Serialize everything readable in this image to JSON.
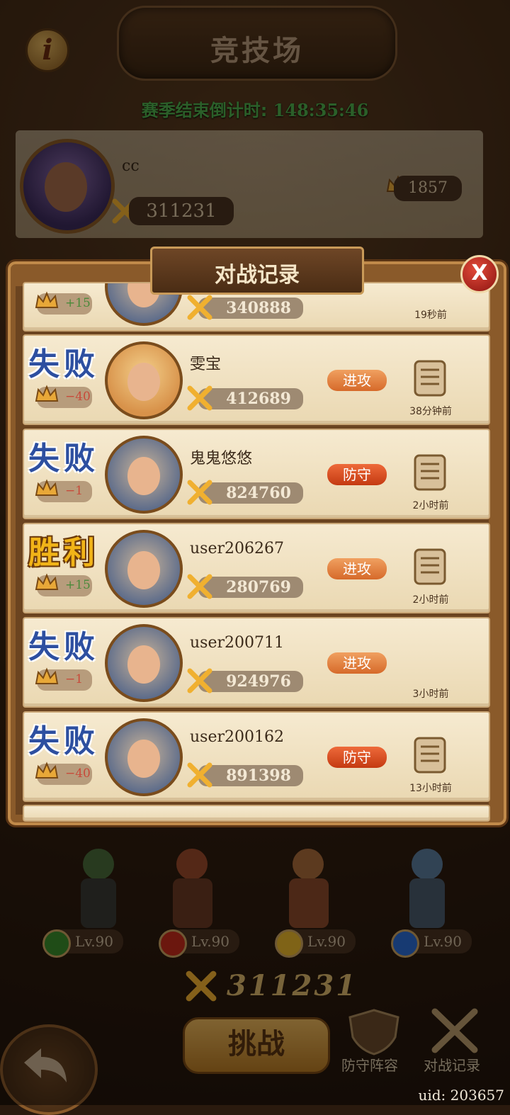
{
  "header": {
    "title": "竞技场",
    "info_icon": "i",
    "countdown_label": "赛季结束倒计时:",
    "countdown_value": "148:35:46"
  },
  "player": {
    "name": "cc",
    "power": "311231",
    "rank_points": "1857"
  },
  "records_dialog": {
    "title": "对战记录",
    "close_label": "X",
    "partial_top": {
      "delta": "+15",
      "power": "340888",
      "ago": "19秒前"
    },
    "rows": [
      {
        "result": "失败",
        "outcome": "lose",
        "delta": "−40",
        "name": "雯宝",
        "power": "412689",
        "type": "进攻",
        "ago": "38分钟前",
        "avatar": "fairy",
        "has_replay": true
      },
      {
        "result": "失败",
        "outcome": "lose",
        "delta": "−1",
        "name": "鬼鬼悠悠",
        "power": "824760",
        "type": "防守",
        "ago": "2小时前",
        "avatar": "engineer",
        "has_replay": true
      },
      {
        "result": "胜利",
        "outcome": "win",
        "delta": "+15",
        "name": "user206267",
        "power": "280769",
        "type": "进攻",
        "ago": "2小时前",
        "avatar": "engineer",
        "has_replay": true
      },
      {
        "result": "失败",
        "outcome": "lose",
        "delta": "−1",
        "name": "user200711",
        "power": "924976",
        "type": "进攻",
        "ago": "3小时前",
        "avatar": "engineer",
        "has_replay": false
      },
      {
        "result": "失败",
        "outcome": "lose",
        "delta": "−40",
        "name": "user200162",
        "power": "891398",
        "type": "防守",
        "ago": "13小时前",
        "avatar": "engineer",
        "has_replay": true
      }
    ]
  },
  "team": {
    "levels": [
      "Lv.90",
      "Lv.90",
      "Lv.90",
      "Lv.90"
    ],
    "element_colors": [
      "#3a8a2a",
      "#c42a1a",
      "#e8b42a",
      "#2a6ad0"
    ],
    "total_power": "311231"
  },
  "bottom": {
    "challenge_label": "挑战",
    "defense_label": "防守阵容",
    "records_label": "对战记录",
    "uid": "uid: 203657"
  }
}
